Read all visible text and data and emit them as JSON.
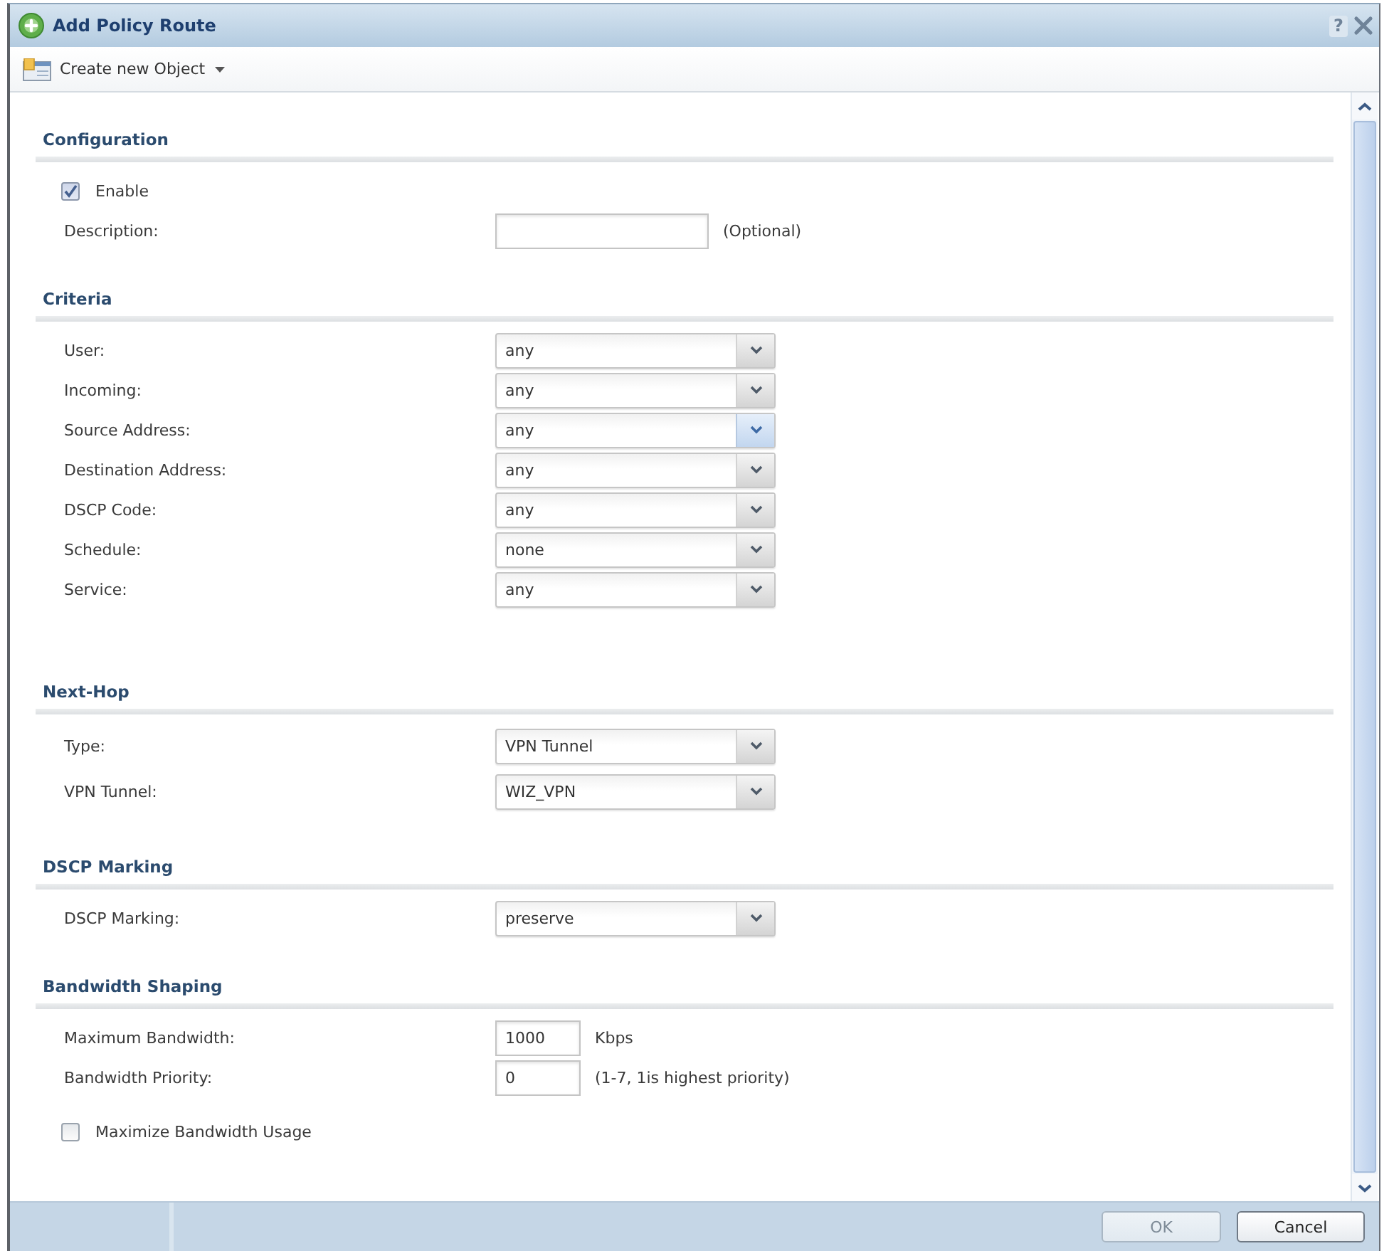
{
  "window": {
    "title": "Add Policy Route",
    "help_button": "?"
  },
  "toolbar": {
    "menu_button": "Create new Object"
  },
  "sections": [
    {
      "title": "Configuration",
      "fields": [
        {
          "kind": "checkbox",
          "label": "Enable",
          "checked": true
        },
        {
          "kind": "text",
          "label": "Description:",
          "note": "(Optional)"
        }
      ]
    },
    {
      "title": "Criteria",
      "fields": [
        {
          "kind": "select",
          "label": "User:",
          "value": "any",
          "hovered": false
        },
        {
          "kind": "select",
          "label": "Incoming:",
          "value": "any",
          "hovered": false
        },
        {
          "kind": "select",
          "label": "Source Address:",
          "value": "any",
          "hovered": true
        },
        {
          "kind": "select",
          "label": "Destination Address:",
          "value": "any",
          "hovered": false
        },
        {
          "kind": "select",
          "label": "DSCP Code:",
          "value": "any",
          "hovered": false
        },
        {
          "kind": "select",
          "label": "Schedule:",
          "value": "none",
          "hovered": false
        },
        {
          "kind": "select",
          "label": "Service:",
          "value": "any",
          "hovered": false
        }
      ]
    },
    {
      "title": "Next-Hop",
      "fields": [
        {
          "kind": "select",
          "label": "Type:",
          "value": "VPN Tunnel",
          "hovered": false
        },
        {
          "kind": "select",
          "label": "VPN Tunnel:",
          "value": "WIZ_VPN",
          "hovered": false
        }
      ]
    },
    {
      "title": "DSCP Marking",
      "fields": [
        {
          "kind": "select",
          "label": "DSCP Marking:",
          "value": "preserve",
          "hovered": false
        }
      ]
    },
    {
      "title": "Bandwidth Shaping",
      "fields": [
        {
          "kind": "number",
          "label": "Maximum Bandwidth:",
          "value": "1000",
          "note": "Kbps"
        },
        {
          "kind": "number",
          "label": "Bandwidth Priority:",
          "value": "0",
          "note": "(1-7, 1is highest priority)"
        },
        {
          "kind": "checkbox",
          "label": "Maximize Bandwidth Usage",
          "checked": false
        }
      ]
    }
  ],
  "buttons": [
    {
      "label": "OK",
      "disabled": true
    },
    {
      "label": "Cancel",
      "disabled": false
    }
  ]
}
